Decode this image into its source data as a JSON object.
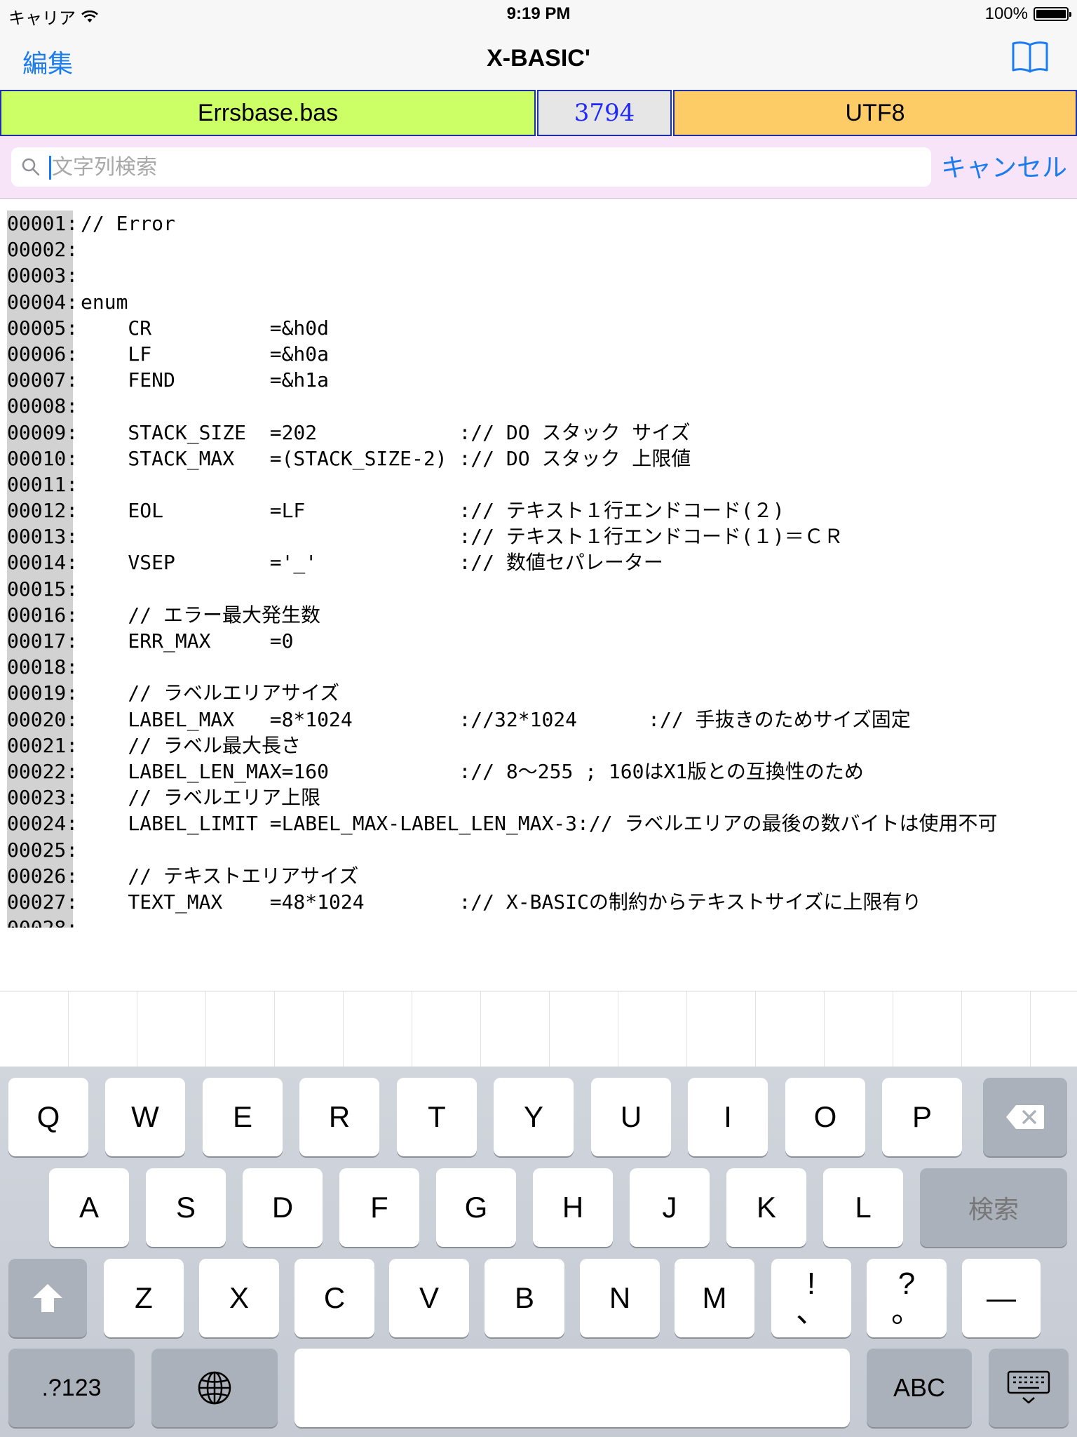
{
  "status_bar": {
    "carrier": "キャリア",
    "time": "9:19 PM",
    "battery": "100%"
  },
  "nav": {
    "edit_label": "編集",
    "title": "X-BASIC'",
    "right_icon": "book-icon"
  },
  "info_bar": {
    "filename": "Errsbase.bas",
    "count": "3794",
    "encoding": "UTF8"
  },
  "search": {
    "placeholder": "文字列検索",
    "value": "",
    "cancel_label": "キャンセル"
  },
  "code_lines": [
    {
      "num": "00001:",
      "text": "// Error"
    },
    {
      "num": "00002:",
      "text": ""
    },
    {
      "num": "00003:",
      "text": ""
    },
    {
      "num": "00004:",
      "text": "enum"
    },
    {
      "num": "00005:",
      "text": "    CR          =&h0d"
    },
    {
      "num": "00006:",
      "text": "    LF          =&h0a"
    },
    {
      "num": "00007:",
      "text": "    FEND        =&h1a"
    },
    {
      "num": "00008:",
      "text": ""
    },
    {
      "num": "00009:",
      "text": "    STACK_SIZE  =202            :// DO スタック サイズ"
    },
    {
      "num": "00010:",
      "text": "    STACK_MAX   =(STACK_SIZE-2) :// DO スタック 上限値"
    },
    {
      "num": "00011:",
      "text": ""
    },
    {
      "num": "00012:",
      "text": "    EOL         =LF             :// テキスト１行エンドコード(２)"
    },
    {
      "num": "00013:",
      "text": "                                :// テキスト１行エンドコード(１)＝ＣＲ"
    },
    {
      "num": "00014:",
      "text": "    VSEP        ='_'            :// 数値セパレーター"
    },
    {
      "num": "00015:",
      "text": ""
    },
    {
      "num": "00016:",
      "text": "    // エラー最大発生数"
    },
    {
      "num": "00017:",
      "text": "    ERR_MAX     =0"
    },
    {
      "num": "00018:",
      "text": ""
    },
    {
      "num": "00019:",
      "text": "    // ラベルエリアサイズ"
    },
    {
      "num": "00020:",
      "text": "    LABEL_MAX   =8*1024         ://32*1024      :// 手抜きのためサイズ固定"
    },
    {
      "num": "00021:",
      "text": "    // ラベル最大長さ"
    },
    {
      "num": "00022:",
      "text": "    LABEL_LEN_MAX=160           :// 8～255 ; 160はX1版との互換性のため"
    },
    {
      "num": "00023:",
      "text": "    // ラベルエリア上限"
    },
    {
      "num": "00024:",
      "text": "    LABEL_LIMIT =LABEL_MAX-LABEL_LEN_MAX-3:// ラベルエリアの最後の数バイトは使用不可"
    },
    {
      "num": "00025:",
      "text": ""
    },
    {
      "num": "00026:",
      "text": "    // テキストエリアサイズ"
    },
    {
      "num": "00027:",
      "text": "    TEXT_MAX    =48*1024        :// X-BASICの制約からテキストサイズに上限有り"
    },
    {
      "num": "00028:",
      "text": ""
    }
  ],
  "keyboard": {
    "row1": [
      "Q",
      "W",
      "E",
      "R",
      "T",
      "Y",
      "U",
      "I",
      "O",
      "P"
    ],
    "row2": [
      "A",
      "S",
      "D",
      "F",
      "G",
      "H",
      "J",
      "K",
      "L"
    ],
    "row3": [
      "Z",
      "X",
      "C",
      "V",
      "B",
      "N",
      "M"
    ],
    "search_key": "検索",
    "exclaim_top": "!",
    "exclaim_bottom": "、",
    "question_top": "?",
    "question_bottom": "。",
    "dash_key": "—",
    "numbers_key": ".?123",
    "abc_key": "ABC"
  }
}
